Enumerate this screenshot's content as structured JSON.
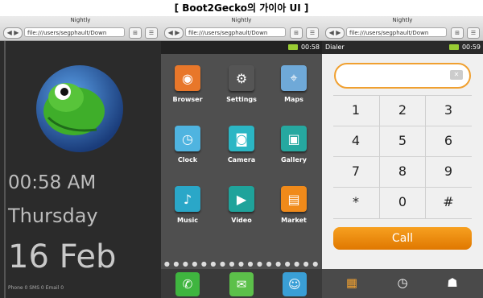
{
  "header": {
    "title": "[ Boot2Gecko의  가이아 UI ]"
  },
  "browser": {
    "window_title": "Nightly",
    "url": "file:///users/segphault/Down",
    "back": "◀ ▶"
  },
  "lock": {
    "time": "00:58 AM",
    "day": "Thursday",
    "date": "16 Feb",
    "status": "Phone 0 SMS 0 Email 0"
  },
  "home": {
    "clock": "00:58",
    "apps": [
      {
        "label": "Browser"
      },
      {
        "label": "Settings"
      },
      {
        "label": "Maps"
      },
      {
        "label": "Clock"
      },
      {
        "label": "Camera"
      },
      {
        "label": "Gallery"
      },
      {
        "label": "Music"
      },
      {
        "label": "Video"
      },
      {
        "label": "Market"
      }
    ],
    "page_dots": "● ● ● ● ● ● ● ● ● ● ● ● ● ● ● ● ● ● ● ●"
  },
  "dialer": {
    "app_title": "Dialer",
    "clock": "00:59",
    "keys": [
      "1",
      "2",
      "3",
      "4",
      "5",
      "6",
      "7",
      "8",
      "9",
      "*",
      "0",
      "#"
    ],
    "call_label": "Call"
  }
}
